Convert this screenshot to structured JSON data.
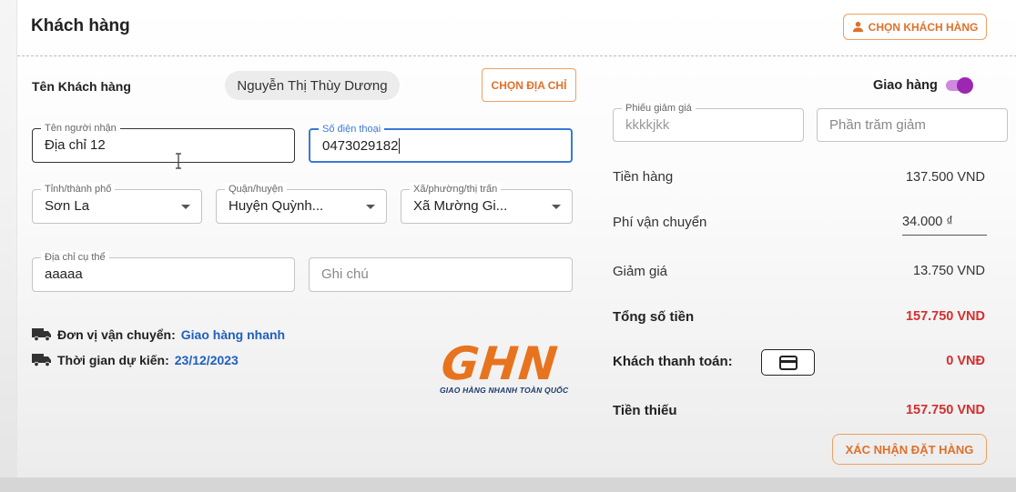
{
  "header": {
    "title": "Khách hàng",
    "choose_customer_label": "CHỌN KHÁCH HÀNG"
  },
  "customer": {
    "name_label": "Tên Khách hàng",
    "name_value": "Nguyễn Thị Thùy Dương",
    "choose_address_label": "CHỌN ĐỊA CHỈ"
  },
  "form": {
    "recipient": {
      "label": "Tên người nhận",
      "value": "Địa chỉ 12"
    },
    "phone": {
      "label": "Số điện thoại",
      "value": "0473029182"
    },
    "province": {
      "label": "Tỉnh/thành phố",
      "value": "Sơn La"
    },
    "district": {
      "label": "Quận/huyện",
      "value": "Huyện Quỳnh..."
    },
    "ward": {
      "label": "Xã/phường/thị trấn",
      "value": "Xã Mường Gi..."
    },
    "address": {
      "label": "Địa chỉ cụ thể",
      "value": "aaaaa"
    },
    "note": {
      "placeholder": "Ghi chú"
    }
  },
  "shipping": {
    "carrier_label": "Đơn vị vận chuyển:",
    "carrier_value": "Giao hàng nhanh",
    "eta_label": "Thời gian dự kiến:",
    "eta_value": "23/12/2023",
    "logo_text": "GHN",
    "logo_tagline": "GIAO HÀNG NHANH TOÀN QUỐC"
  },
  "summary": {
    "delivery_toggle_label": "Giao hàng",
    "delivery_toggle_on": true,
    "voucher": {
      "label": "Phiếu giảm giá",
      "value": "kkkkjkk"
    },
    "percent": {
      "placeholder": "Phần trăm giảm"
    },
    "subtotal_label": "Tiền hàng",
    "subtotal_value": "137.500 VND",
    "shipping_fee_label": "Phí vận chuyển",
    "shipping_fee_value": "34.000 ₫",
    "discount_label": "Giảm giá",
    "discount_value": "13.750 VND",
    "total_label": "Tổng số tiền",
    "total_value": "157.750 VND",
    "paid_label": "Khách thanh toán:",
    "paid_value": "0 VNĐ",
    "missing_label": "Tiền thiếu",
    "missing_value": "157.750 VND",
    "confirm_label": "XÁC NHẬN ĐẶT HÀNG"
  },
  "colors": {
    "accent_orange": "#e0702a",
    "toggle_purple": "#9c27b0",
    "link_blue": "#1f5fbf",
    "amount_red": "#d32f2f",
    "focus_blue": "#3b78d8"
  },
  "icons": {
    "choose_customer": "person-icon",
    "shipping": "truck-icon",
    "payment": "credit-card-icon",
    "dropdown": "caret-down-icon"
  }
}
